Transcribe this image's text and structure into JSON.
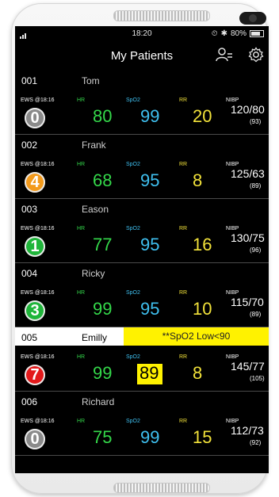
{
  "statusbar": {
    "time": "18:20",
    "battery": "80%"
  },
  "header": {
    "title": "My Patients",
    "left_icon": "patient-list-icon",
    "right_icon": "gear-icon"
  },
  "labels": {
    "hr": "HR",
    "spo2": "SpO2",
    "rr": "RR",
    "nibp": "NIBP"
  },
  "patients": [
    {
      "bed": "001",
      "name": "Tom",
      "ews_label": "EWS @18:16",
      "ews": "0",
      "ews_color": "#8a8a8a",
      "hr": "80",
      "spo2": "99",
      "rr": "20",
      "bp": "120/80",
      "map": "(93)"
    },
    {
      "bed": "002",
      "name": "Frank",
      "ews_label": "EWS @18:16",
      "ews": "4",
      "ews_color": "#f39a1b",
      "hr": "68",
      "spo2": "95",
      "rr": "8",
      "bp": "125/63",
      "map": "(89)"
    },
    {
      "bed": "003",
      "name": "Eason",
      "ews_label": "EWS @18:16",
      "ews": "1",
      "ews_color": "#1fb53a",
      "hr": "77",
      "spo2": "95",
      "rr": "16",
      "bp": "130/75",
      "map": "(96)"
    },
    {
      "bed": "004",
      "name": "Ricky",
      "ews_label": "EWS @18:16",
      "ews": "3",
      "ews_color": "#1fb53a",
      "hr": "99",
      "spo2": "95",
      "rr": "10",
      "bp": "115/70",
      "map": "(89)"
    },
    {
      "bed": "005",
      "name": "Emilly",
      "ews_label": "EWS @18:16",
      "ews": "7",
      "ews_color": "#e3191b",
      "hr": "99",
      "spo2": "89",
      "rr": "8",
      "bp": "145/77",
      "map": "(105)",
      "alarm": "**SpO2 Low<90"
    },
    {
      "bed": "006",
      "name": "Richard",
      "ews_label": "EWS @18:16",
      "ews": "0",
      "ews_color": "#8a8a8a",
      "hr": "75",
      "spo2": "99",
      "rr": "15",
      "bp": "112/73",
      "map": "(92)"
    }
  ]
}
